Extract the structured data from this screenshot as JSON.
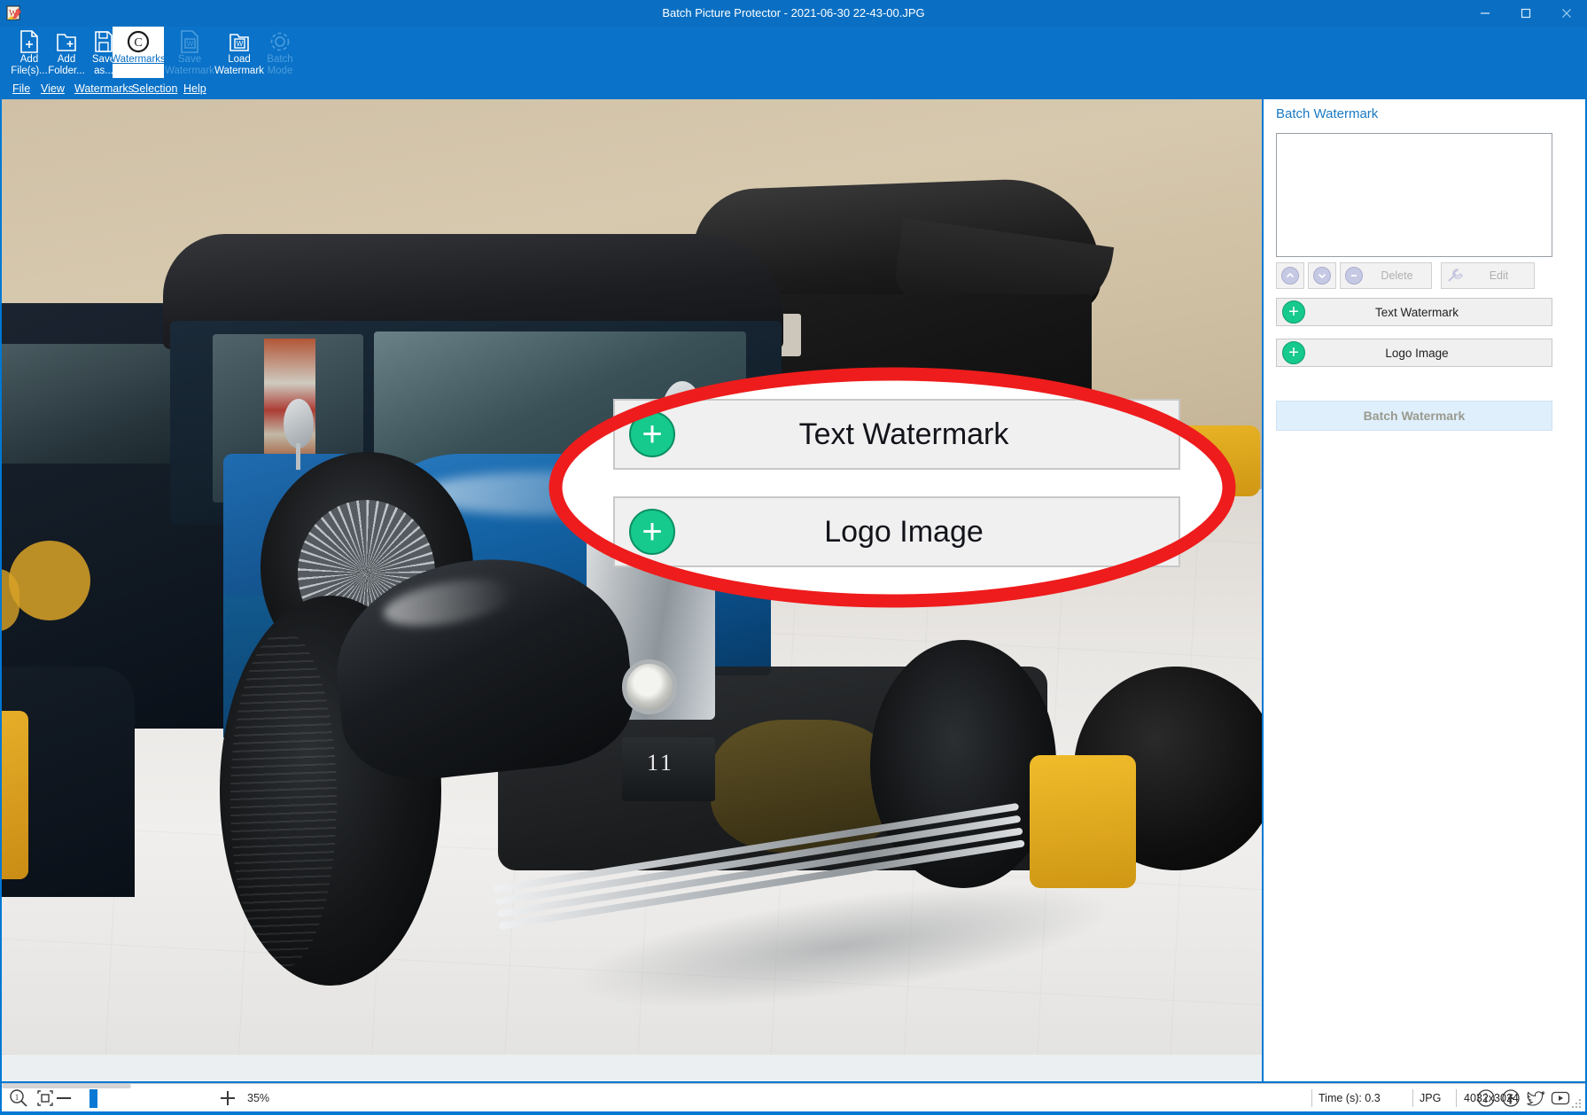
{
  "window": {
    "title": "Batch Picture Protector - 2021-06-30 22-43-00.JPG",
    "app_icon": "app-logo-icon",
    "minimize_label": "–",
    "maximize_label": "□",
    "close_label": "✕"
  },
  "toolbar": {
    "items": [
      {
        "id": "add-files",
        "label": "Add\nFile(s)...",
        "icon": "add-file-icon",
        "state": "enabled"
      },
      {
        "id": "add-folder",
        "label": "Add\nFolder...",
        "icon": "add-folder-icon",
        "state": "enabled"
      },
      {
        "id": "save-as",
        "label": "Save\nas...",
        "icon": "save-disk-icon",
        "state": "enabled"
      },
      {
        "id": "watermarks",
        "label": "Watermarks",
        "icon": "copyright-icon",
        "state": "active"
      },
      {
        "id": "save-watermark",
        "label": "Save\nWatermark",
        "icon": "save-watermark-icon",
        "state": "disabled"
      },
      {
        "id": "load-watermark",
        "label": "Load\nWatermark",
        "icon": "load-watermark-icon",
        "state": "enabled"
      },
      {
        "id": "batch-mode",
        "label": "Batch\nMode",
        "icon": "gear-icon",
        "state": "disabled"
      }
    ]
  },
  "menubar": {
    "items": [
      {
        "id": "file",
        "label": "File"
      },
      {
        "id": "view",
        "label": "View"
      },
      {
        "id": "watermarks",
        "label": "Watermarks"
      },
      {
        "id": "selection",
        "label": "Selection"
      },
      {
        "id": "help",
        "label": "Help"
      }
    ]
  },
  "panel": {
    "title": "Batch Watermark",
    "list_items": [],
    "move_up_label": "",
    "move_down_label": "",
    "delete_label": "Delete",
    "edit_label": "Edit",
    "text_watermark_label": "Text Watermark",
    "logo_image_label": "Logo Image",
    "batch_watermark_label": "Batch Watermark",
    "add_glyph": "+",
    "minus_glyph": "–"
  },
  "callout": {
    "ring_color": "#ee1c1c",
    "text_watermark_label": "Text Watermark",
    "logo_image_label": "Logo Image",
    "add_glyph": "+"
  },
  "statusbar": {
    "zoom_icon": "magnifier-1to1-icon",
    "fit_icon": "fit-to-window-icon",
    "zoom_out_glyph": "—",
    "zoom_in_glyph": "+",
    "zoom_value": "35%",
    "time_label": "Time (s): 0.3",
    "format_label": "JPG",
    "dimensions_label": "4032x3024",
    "social": [
      {
        "id": "info",
        "icon": "info-circle-icon"
      },
      {
        "id": "facebook",
        "icon": "facebook-icon"
      },
      {
        "id": "twitter",
        "icon": "twitter-bird-icon"
      },
      {
        "id": "youtube",
        "icon": "youtube-play-icon"
      }
    ]
  },
  "photo": {
    "license_plate": "11",
    "description": "Vintage blue automobile in a museum"
  },
  "colors": {
    "titlebar": "#0a6fc2",
    "ribbon": "#0a72c8",
    "accent_link": "#1a7ac4",
    "add_button_green": "#16c98d",
    "highlight_blue": "#dfeffc",
    "callout_red": "#ee1c1c"
  }
}
